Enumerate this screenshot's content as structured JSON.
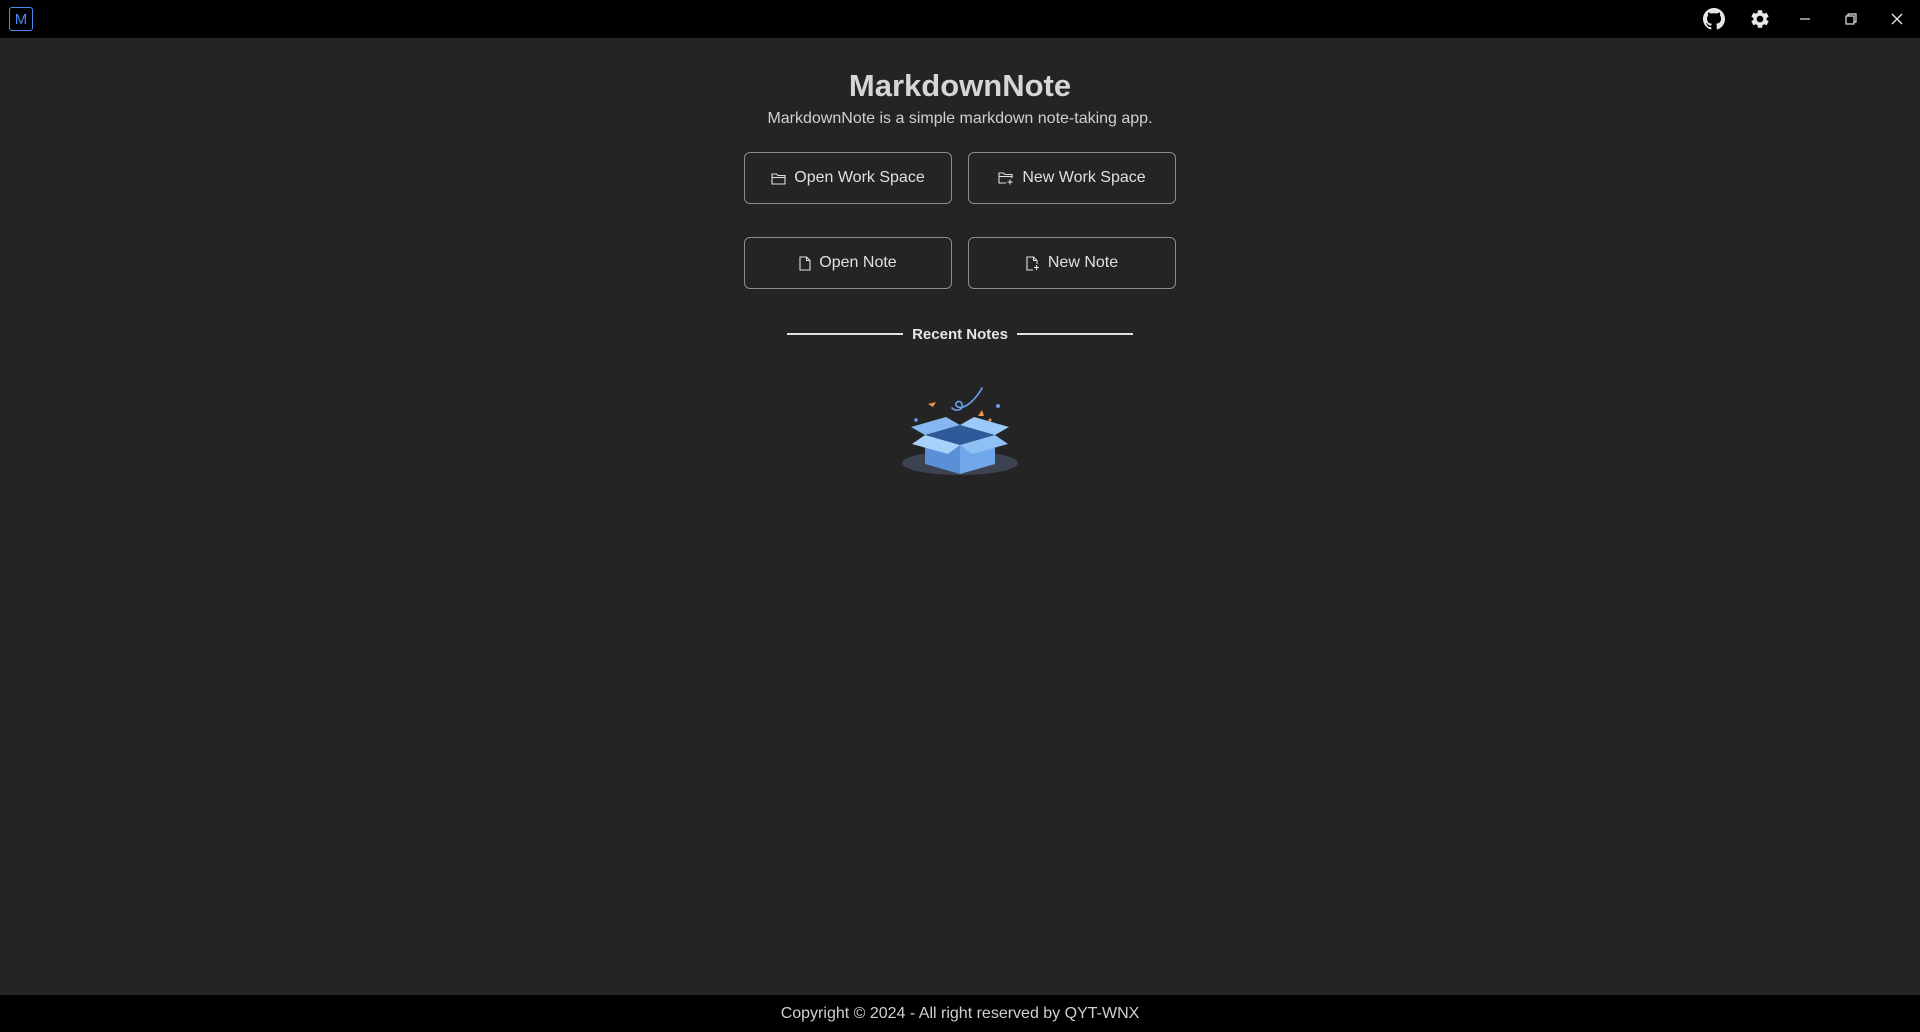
{
  "titlebar": {
    "logo_letter": "M",
    "accent_color": "#4a8af4",
    "icons": [
      "github-icon",
      "settings-gear-icon",
      "minimize-icon",
      "restore-icon",
      "close-icon"
    ]
  },
  "main": {
    "title": "MarkdownNote",
    "subtitle": "MarkdownNote is a simple markdown note-taking app.",
    "buttons": {
      "open_workspace": "Open Work Space",
      "new_workspace": "New Work Space",
      "open_note": "Open Note",
      "new_note": "New Note"
    },
    "recent_notes_label": "Recent Notes",
    "empty_illustration": "empty-box-icon"
  },
  "footer": {
    "copyright": "Copyright © 2024 - All right reserved by QYT-WNX"
  }
}
